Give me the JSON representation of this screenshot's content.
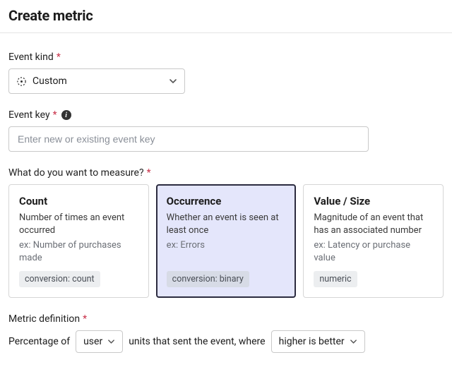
{
  "title": "Create metric",
  "eventKind": {
    "label": "Event kind",
    "required": "*",
    "value": "Custom"
  },
  "eventKey": {
    "label": "Event key",
    "required": "*",
    "placeholder": "Enter new or existing event key"
  },
  "measure": {
    "label": "What do you want to measure?",
    "required": "*",
    "options": [
      {
        "title": "Count",
        "desc": "Number of times an event occurred",
        "ex": "ex: Number of purchases made",
        "tag": "conversion: count",
        "selected": false
      },
      {
        "title": "Occurrence",
        "desc": "Whether an event is seen at least once",
        "ex": "ex: Errors",
        "tag": "conversion: binary",
        "selected": true
      },
      {
        "title": "Value / Size",
        "desc": "Magnitude of an event that has an associated number",
        "ex": "ex: Latency or purchase value",
        "tag": "numeric",
        "selected": false
      }
    ]
  },
  "definition": {
    "label": "Metric definition",
    "required": "*",
    "prefix": "Percentage of",
    "unit": "user",
    "midText": "units that sent the event, where",
    "direction": "higher is better"
  }
}
